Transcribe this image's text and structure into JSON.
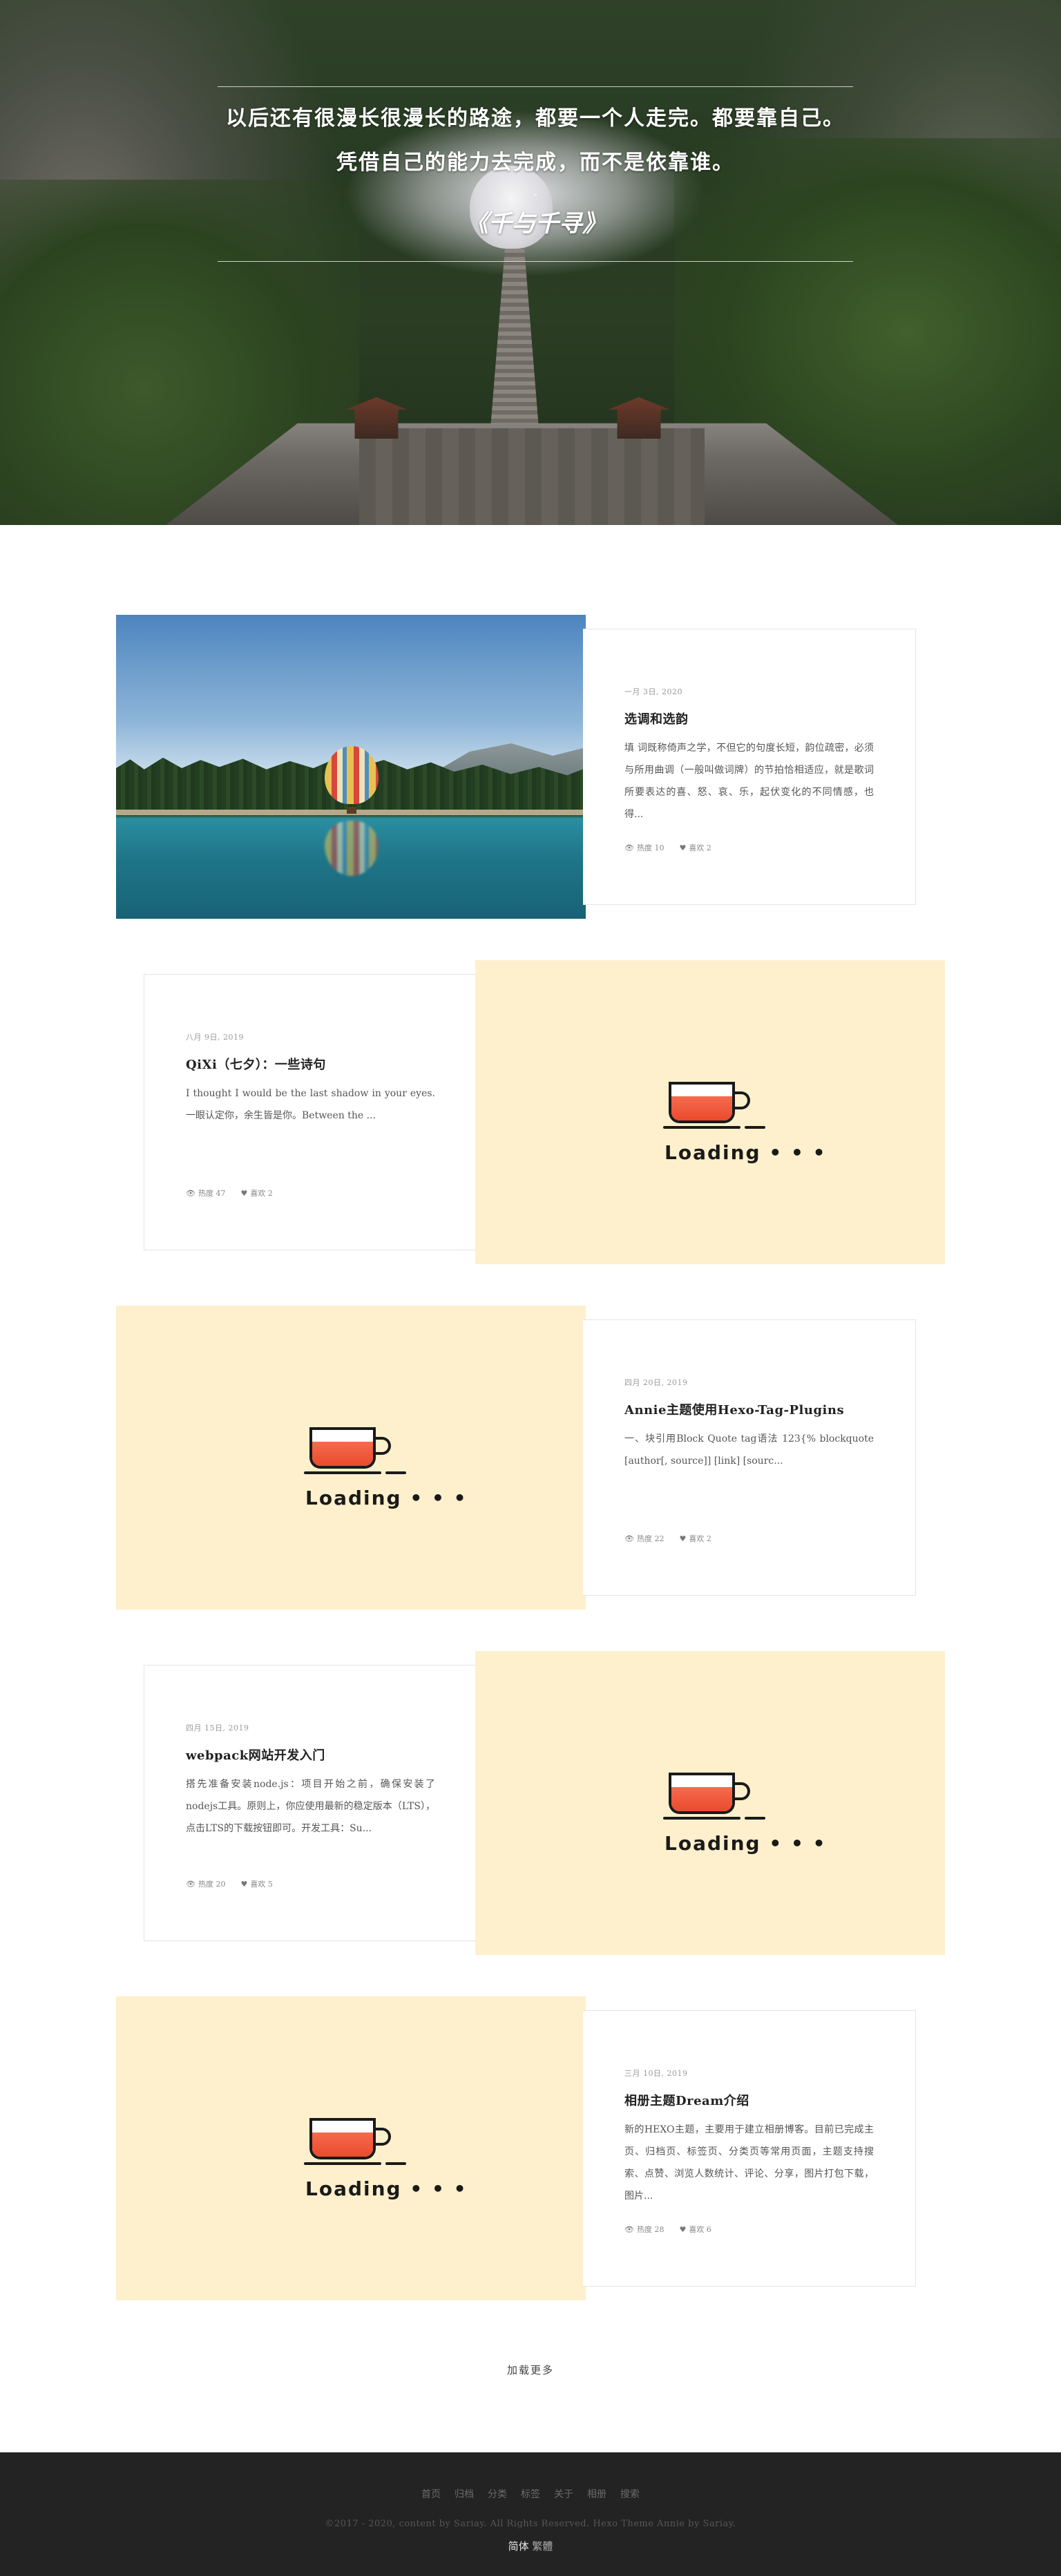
{
  "hero": {
    "quote_line_1": "以后还有很漫长很漫长的路途，都要一个人走完。都要靠自己。",
    "quote_line_2": "凭借自己的能力去完成，而不是依靠谁。",
    "dash": "-",
    "source": "《千与千寻》"
  },
  "posts": [
    {
      "date": "一月 3日, 2020",
      "title": "选调和选韵",
      "excerpt": "填 词既称倚声之学，不但它的句度长短，韵位疏密，必须与所用曲调（一般叫做词牌）的节拍恰相适应，就是歌词所要表达的喜、怒、哀、乐，起伏变化的不同情感，也得...",
      "views": "热度 10",
      "likes": "喜欢 2",
      "media": "photo"
    },
    {
      "date": "八月 9日, 2019",
      "title": "QiXi（七夕）：一些诗句",
      "excerpt": "I thought I would be the last shadow in your eyes. 一眼认定你，余生皆是你。Between the ...",
      "views": "热度 47",
      "likes": "喜欢 2",
      "media": "loading"
    },
    {
      "date": "四月 20日, 2019",
      "title": "Annie主题使用Hexo-Tag-Plugins",
      "excerpt": "一、块引用Block Quote tag语法 123{% blockquote [author[, source]] [link] [sourc...",
      "views": "热度 22",
      "likes": "喜欢 2",
      "media": "loading"
    },
    {
      "date": "四月 15日, 2019",
      "title": "webpack网站开发入门",
      "excerpt": "搭先准备安装node.js：项目开始之前，确保安装了nodejs工具。原则上，你应使用最新的稳定版本（LTS），点击LTS的下载按钮即可。开发工具：Su...",
      "views": "热度 20",
      "likes": "喜欢 5",
      "media": "loading"
    },
    {
      "date": "三月 10日, 2019",
      "title": "相册主题Dream介绍",
      "excerpt": "新的HEXO主题，主要用于建立相册博客。目前已完成主页、归档页、标签页、分类页等常用页面，主题支持搜索、点赞、浏览人数统计、评论、分享，图片打包下载，图片...",
      "views": "热度 28",
      "likes": "喜欢 6",
      "media": "loading"
    }
  ],
  "loading_label": "Loading • • •",
  "load_more": "加载更多",
  "footer": {
    "nav": [
      "首页",
      "归档",
      "分类",
      "标签",
      "关于",
      "相册",
      "搜索"
    ],
    "copyright": "©2017 - 2020, content by Sariay. All Rights Reserved. Hexo Theme Annie by Sariay.",
    "lang_simplified": "简体",
    "lang_traditional": "繁體"
  },
  "icons": {
    "views": "eye-icon",
    "likes": "heart-icon"
  }
}
